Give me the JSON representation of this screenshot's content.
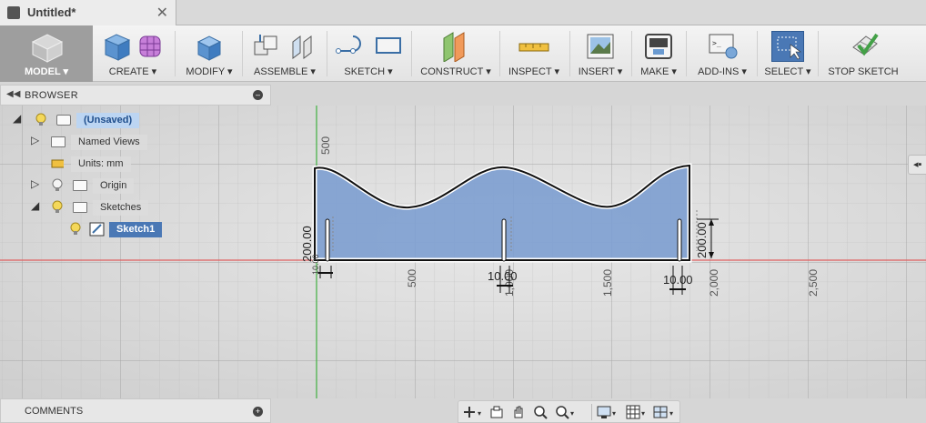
{
  "document": {
    "title": "Untitled*"
  },
  "toolbar": {
    "model": "MODEL ▾",
    "create": "CREATE ▾",
    "modify": "MODIFY ▾",
    "assemble": "ASSEMBLE ▾",
    "sketch": "SKETCH ▾",
    "construct": "CONSTRUCT ▾",
    "inspect": "INSPECT ▾",
    "insert": "INSERT ▾",
    "make": "MAKE ▾",
    "addins": "ADD-INS ▾",
    "select": "SELECT ▾",
    "stop_sketch": "STOP SKETCH"
  },
  "browser": {
    "title": "BROWSER",
    "items": {
      "root": "(Unsaved)",
      "named_views": "Named Views",
      "units": "Units: mm",
      "origin": "Origin",
      "sketches": "Sketches",
      "sketch1": "Sketch1"
    }
  },
  "comments": {
    "title": "COMMENTS"
  },
  "canvas": {
    "x_ticks": [
      "500",
      "1,000",
      "1,500",
      "2,000",
      "2,500"
    ],
    "y_tick": "500",
    "dimensions": {
      "left_height": "200.00",
      "right_height": "200.00",
      "left_width": "10.00",
      "mid_width": "10.00",
      "right_width": "10.00"
    }
  },
  "colors": {
    "accent": "#4a78b5",
    "sketch_fill": "#7d9fd0",
    "x_axis": "#e06060",
    "y_axis": "#40b040"
  }
}
